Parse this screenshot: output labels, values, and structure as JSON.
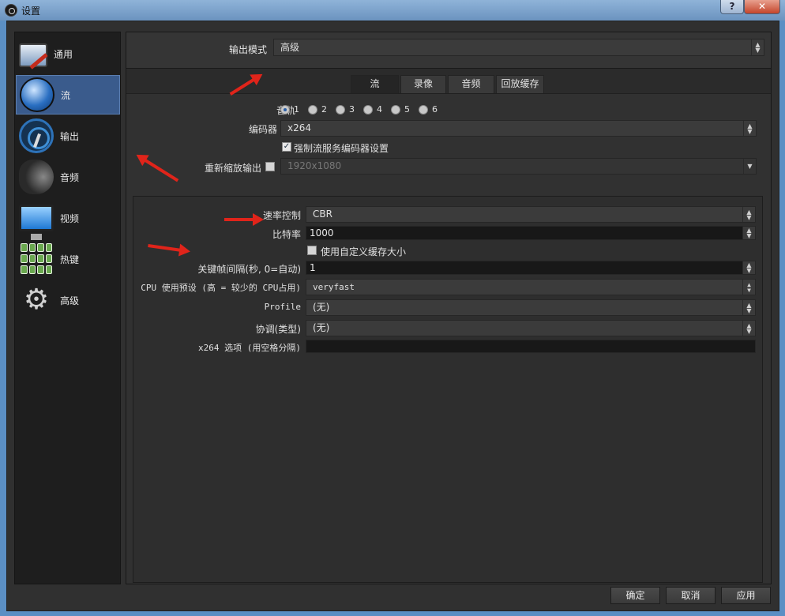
{
  "window": {
    "title": "设置"
  },
  "titlebar": {
    "help_label": "?",
    "close_label": "✕"
  },
  "sidebar": {
    "items": [
      {
        "label": "通用",
        "icon": "general-icon"
      },
      {
        "label": "流",
        "icon": "stream-globe-icon"
      },
      {
        "label": "输出",
        "icon": "output-broadcast-icon"
      },
      {
        "label": "音频",
        "icon": "speaker-icon"
      },
      {
        "label": "视频",
        "icon": "monitor-icon"
      },
      {
        "label": "热键",
        "icon": "keyboard-icon"
      },
      {
        "label": "高级",
        "icon": "gears-icon"
      }
    ],
    "active_index": 1
  },
  "output_mode": {
    "label": "输出模式",
    "value": "高级"
  },
  "tabs": [
    {
      "label": "流",
      "active": true
    },
    {
      "label": "录像",
      "active": false
    },
    {
      "label": "音频",
      "active": false
    },
    {
      "label": "回放缓存",
      "active": false
    }
  ],
  "stream": {
    "audio_track_label": "音轨",
    "audio_tracks": [
      "1",
      "2",
      "3",
      "4",
      "5",
      "6"
    ],
    "audio_track_selected": "1",
    "encoder_label": "编码器",
    "encoder_value": "x264",
    "enforce_label": "强制流服务编码器设置",
    "enforce_checked": true,
    "rescale_label": "重新缩放输出",
    "rescale_checked": false,
    "rescale_value": "1920x1080"
  },
  "encoder_settings": {
    "rate_control_label": "速率控制",
    "rate_control_value": "CBR",
    "bitrate_label": "比特率",
    "bitrate_value": "1000",
    "custom_buffer_label": "使用自定义缓存大小",
    "custom_buffer_checked": false,
    "keyframe_label": "关键帧间隔(秒, 0=自动)",
    "keyframe_value": "1",
    "cpu_preset_label": "CPU 使用预设 (高 = 较少的 CPU占用)",
    "cpu_preset_value": "veryfast",
    "profile_label": "Profile",
    "profile_value": "(无)",
    "tune_label": "协调(类型)",
    "tune_value": "(无)",
    "x264_opts_label": "x264 选项 (用空格分隔)",
    "x264_opts_value": ""
  },
  "buttons": {
    "ok": "确定",
    "cancel": "取消",
    "apply": "应用"
  },
  "colors": {
    "accent_selected": "#3a5b8c",
    "annotation": "#e0241a",
    "background": "#303030"
  }
}
